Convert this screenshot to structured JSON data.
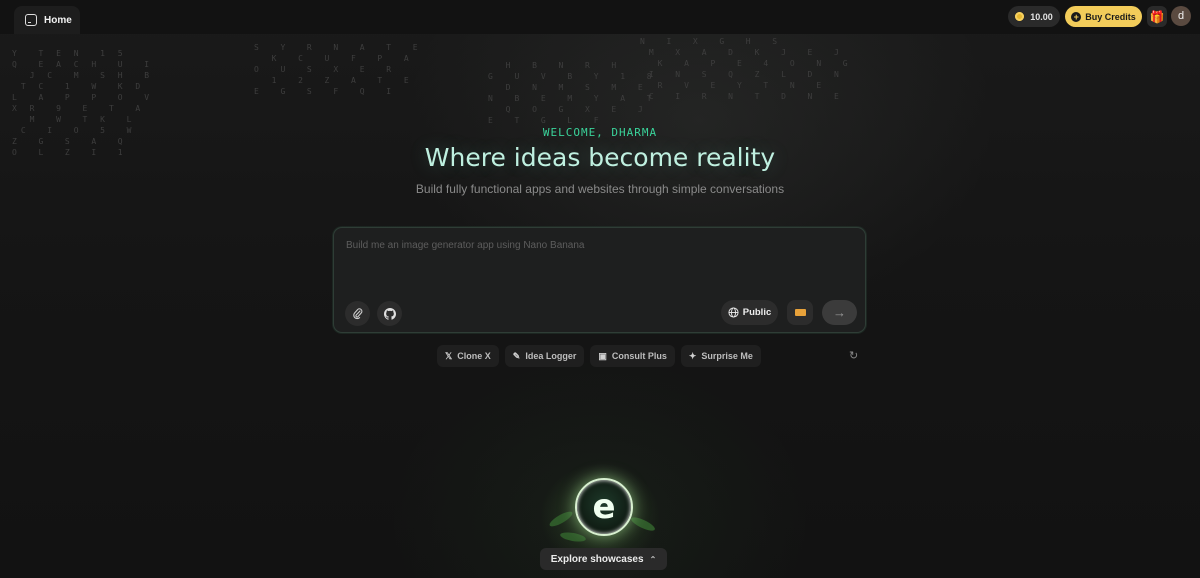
{
  "topbar": {
    "home_tab_label": "Home",
    "credits_value": "10.00",
    "buy_credits_label": "Buy Credits",
    "avatar_initial": "d"
  },
  "hero": {
    "welcome": "WELCOME, DHARMA",
    "headline": "Where ideas become reality",
    "subheadline": "Build fully functional apps and websites through simple conversations"
  },
  "prompt": {
    "placeholder": "Build me an image generator app using Nano Banana",
    "value": "",
    "visibility_label": "Public",
    "icons": {
      "attach": "paperclip-icon",
      "github": "github-icon",
      "globe": "globe-icon",
      "model": "model-icon",
      "send": "arrow-right-icon"
    }
  },
  "suggestions": [
    {
      "icon": "x-logo-icon",
      "label": "Clone X"
    },
    {
      "icon": "idea-icon",
      "label": "Idea Logger"
    },
    {
      "icon": "window-icon",
      "label": "Consult Plus"
    },
    {
      "icon": "sparkle-icon",
      "label": "Surprise Me"
    }
  ],
  "showcase": {
    "logo_letter": "e",
    "explore_label": "Explore showcases"
  },
  "colors": {
    "accent_green": "#3ad39a",
    "headline": "#bff0e0",
    "buy_button": "#f2cc5a",
    "background": "#141414"
  }
}
